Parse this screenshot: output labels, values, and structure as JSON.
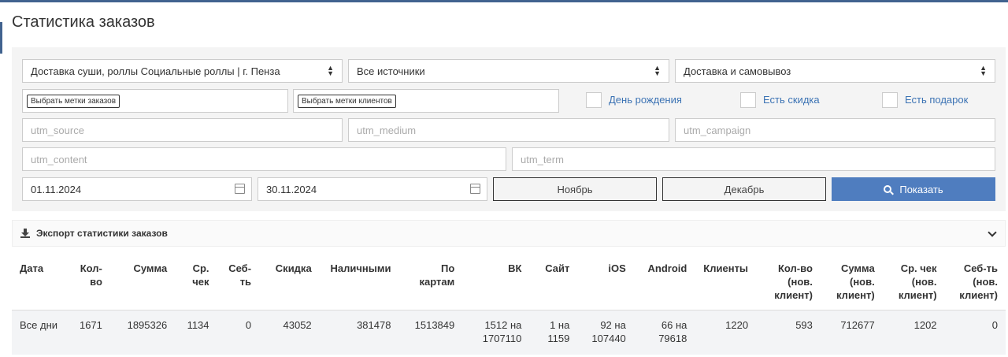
{
  "page": {
    "title": "Статистика заказов"
  },
  "filters": {
    "restaurant": "Доставка суши, роллы Социальные роллы | г. Пенза",
    "source": "Все источники",
    "delivery": "Доставка и самовывоз",
    "order_tags_button": "Выбрать метки заказов",
    "client_tags_button": "Выбрать метки клиентов",
    "birthday_label": "День рождения",
    "discount_label": "Есть скидка",
    "gift_label": "Есть подарок",
    "utm_source_placeholder": "utm_source",
    "utm_medium_placeholder": "utm_medium",
    "utm_campaign_placeholder": "utm_campaign",
    "utm_content_placeholder": "utm_content",
    "utm_term_placeholder": "utm_term",
    "date_from": "01.11.2024",
    "date_to": "30.11.2024",
    "month_prev": "Ноябрь",
    "month_next": "Декабрь",
    "show_button": "Показать"
  },
  "export": {
    "label": "Экспорт статистики заказов"
  },
  "table": {
    "headers": {
      "date": "Дата",
      "count": "Кол-во",
      "sum": "Сумма",
      "avg": "Ср. чек",
      "cost": "Себ-ть",
      "discount": "Скидка",
      "cash": "Наличными",
      "card": "По картам",
      "vk": "ВК",
      "site": "Сайт",
      "ios": "iOS",
      "android": "Android",
      "clients": "Клиенты",
      "new_count": "Кол-во (нов. клиент)",
      "new_sum": "Сумма (нов. клиент)",
      "new_avg": "Ср. чек (нов. клиент)",
      "new_cost": "Себ-ть (нов. клиент)"
    },
    "row": {
      "date": "Все дни",
      "count": "1671",
      "sum": "1895326",
      "avg": "1134",
      "cost": "0",
      "discount": "43052",
      "cash": "381478",
      "card": "1513849",
      "vk": "1512 на 1707110",
      "site": "1 на 1159",
      "ios": "92 на 107440",
      "android": "66 на 79618",
      "clients": "1220",
      "new_count": "593",
      "new_sum": "712677",
      "new_avg": "1202",
      "new_cost": "0"
    }
  }
}
